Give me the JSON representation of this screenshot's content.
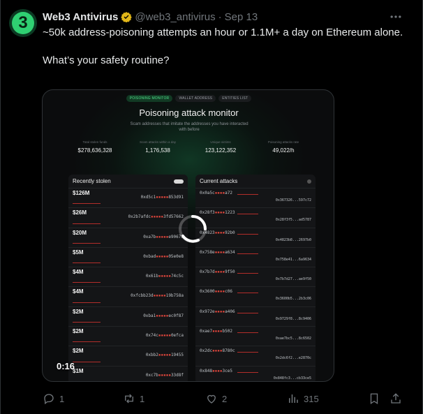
{
  "tweet": {
    "author_name": "Web3 Antivirus",
    "avatar_text": "3",
    "handle": "@web3_antivirus",
    "separator": "·",
    "date": "Sep 13",
    "text_line1": "~50k address-poisoning attempts an hour or 1.1M+ a day on Ethereum alone.",
    "text_line2": "What’s your safety routine?",
    "colors": {
      "background": "#000000",
      "accent_green": "#2fd072",
      "muted": "#71767b",
      "verified_gold": "#e2b719"
    }
  },
  "media": {
    "tabs": [
      "POISONING MONITOR",
      "WALLET ADDRESS",
      "ENTITIES LIST"
    ],
    "title": "Poisoning attack monitor",
    "subtitle": "Scam addresses that imitate the addresses you have interacted with before",
    "stats": [
      {
        "label": "Total stolen funds",
        "value": "$278,636,328"
      },
      {
        "label": "Scam attacks within a day",
        "value": "1,176,538"
      },
      {
        "label": "Unique victims",
        "value": "123,122,352"
      },
      {
        "label": "Poisoning attacks rate",
        "value": "49,022/h"
      }
    ],
    "recently_stolen": {
      "title": "Recently stolen",
      "rows": [
        {
          "amount": "$126M",
          "addr_a": "0xd5c1",
          "addr_b": "853d91"
        },
        {
          "amount": "$26M",
          "addr_a": "0x2b7afdc",
          "addr_b": "3fd57662"
        },
        {
          "amount": "$20M",
          "addr_a": "0xa7b",
          "addr_b": "e90673"
        },
        {
          "amount": "$5M",
          "addr_a": "0xbad",
          "addr_b": "05e0e8"
        },
        {
          "amount": "$4M",
          "addr_a": "0x61b",
          "addr_b": "74c5c"
        },
        {
          "amount": "$4M",
          "addr_a": "0xfcbb23d",
          "addr_b": "19b758a"
        },
        {
          "amount": "$2M",
          "addr_a": "0xba1",
          "addr_b": "ec0f87"
        },
        {
          "amount": "$2M",
          "addr_a": "0x74c",
          "addr_b": "0efca"
        },
        {
          "amount": "$2M",
          "addr_a": "0xbb2",
          "addr_b": "19455"
        },
        {
          "amount": "$1M",
          "addr_a": "0xc7b",
          "addr_b": "33d8f"
        }
      ]
    },
    "current_attacks": {
      "title": "Current attacks",
      "rows": [
        {
          "addr": "0x0a5c",
          "addr_end": "a72",
          "to": "0x367326...597c72"
        },
        {
          "addr": "0x28f3",
          "addr_end": "1223",
          "to": "0x28f3f5...ad5787"
        },
        {
          "addr": "0x4823",
          "addr_end": "92b0",
          "to": "0x4823b8...2697b0"
        },
        {
          "addr": "0x758e",
          "addr_end": "a634",
          "to": "0x758e41...6a9634"
        },
        {
          "addr": "0x7b7d",
          "addr_end": "9f50",
          "to": "0x7b7d27...ae9f50"
        },
        {
          "addr": "0x3600",
          "addr_end": "c06",
          "to": "0x3600b5...2b3c06"
        },
        {
          "addr": "0x972e",
          "addr_end": "a406",
          "to": "0x9729f8...8c9406"
        },
        {
          "addr": "0xae7",
          "addr_end": "b502",
          "to": "0xae7bc5...8c6502"
        },
        {
          "addr": "0x2dc",
          "addr_end": "8780c",
          "to": "0x2dc6f2...e2870c"
        },
        {
          "addr": "0x848",
          "addr_end": "3ce5",
          "to": "0x848fc3...cb33ce5"
        }
      ]
    },
    "video_time": "0:16"
  },
  "actions": {
    "replies": "1",
    "retweets": "1",
    "likes": "2",
    "views": "315"
  }
}
